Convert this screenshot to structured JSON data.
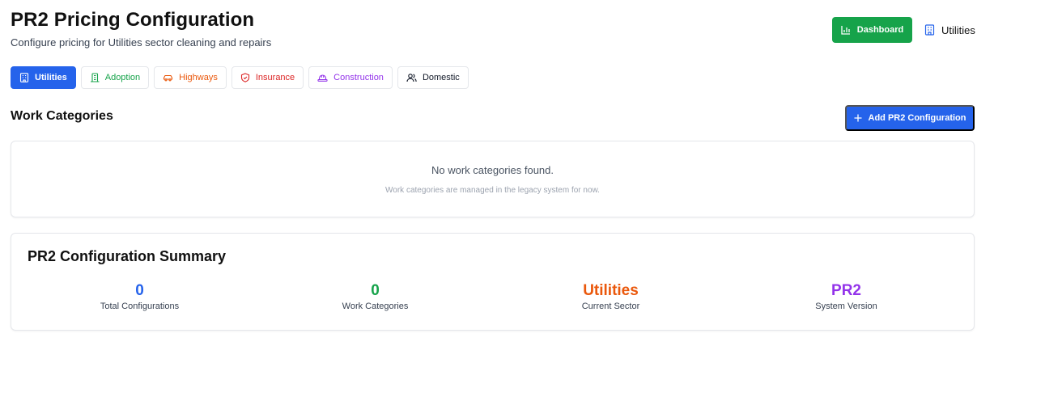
{
  "header": {
    "title": "PR2 Pricing Configuration",
    "subtitle": "Configure pricing for Utilities sector cleaning and repairs"
  },
  "top_actions": {
    "dashboard_label": "Dashboard",
    "current_sector": "Utilities"
  },
  "tabs": [
    {
      "label": "Utilities",
      "icon": "building-icon",
      "color": "#ffffff",
      "active": true
    },
    {
      "label": "Adoption",
      "icon": "adoption-building-icon",
      "color": "#16a34a",
      "active": false
    },
    {
      "label": "Highways",
      "icon": "car-icon",
      "color": "#ea580c",
      "active": false
    },
    {
      "label": "Insurance",
      "icon": "shield-icon",
      "color": "#dc2626",
      "active": false
    },
    {
      "label": "Construction",
      "icon": "hard-hat-icon",
      "color": "#9333ea",
      "active": false
    },
    {
      "label": "Domestic",
      "icon": "users-icon",
      "color": "#111827",
      "active": false
    }
  ],
  "work_categories": {
    "title": "Work Categories",
    "add_button_label": "Add PR2 Configuration",
    "empty_title": "No work categories found.",
    "empty_subtitle": "Work categories are managed in the legacy system for now."
  },
  "summary": {
    "title": "PR2 Configuration Summary",
    "stats": [
      {
        "value": "0",
        "label": "Total Configurations",
        "color": "#2563eb"
      },
      {
        "value": "0",
        "label": "Work Categories",
        "color": "#16a34a"
      },
      {
        "value": "Utilities",
        "label": "Current Sector",
        "color": "#ea580c"
      },
      {
        "value": "PR2",
        "label": "System Version",
        "color": "#9333ea"
      }
    ]
  },
  "colors": {
    "primary": "#2563eb",
    "success": "#16a34a"
  }
}
